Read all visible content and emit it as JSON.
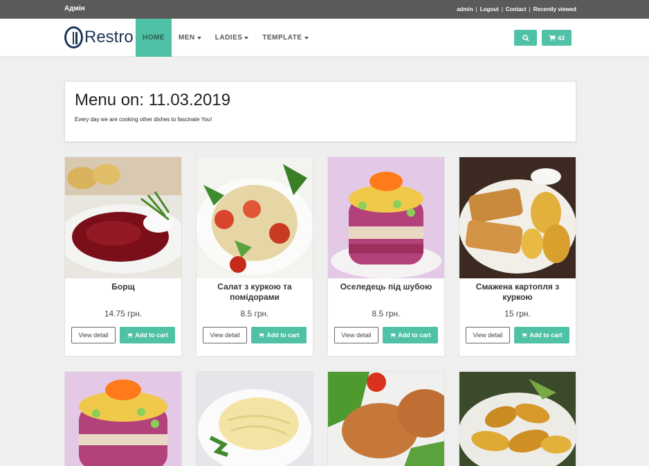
{
  "topbar": {
    "admin_label": "Адмін",
    "links": [
      "admin",
      "Logout",
      "Contact",
      "Recently viewed"
    ]
  },
  "navbar": {
    "logo_text": "Restro",
    "items": [
      {
        "label": "HOME",
        "active": true,
        "dropdown": false
      },
      {
        "label": "MEN",
        "active": false,
        "dropdown": true
      },
      {
        "label": "LADIES",
        "active": false,
        "dropdown": true
      },
      {
        "label": "TEMPLATE",
        "active": false,
        "dropdown": true
      }
    ],
    "search_icon": "search-icon",
    "cart_icon": "cart-icon",
    "cart_count": "43"
  },
  "menu": {
    "title": "Menu on: 11.03.2019",
    "subtitle": "Every day we are cooking other dishes to fascinate You!"
  },
  "products": [
    {
      "name": "Борщ",
      "price": "14.75 грн.",
      "image": "borscht"
    },
    {
      "name": "Салат з куркою та помідорами",
      "price": "8.5 грн.",
      "image": "chicken-salad"
    },
    {
      "name": "Оселедець під шубою",
      "price": "8.5 грн.",
      "image": "herring-salad"
    },
    {
      "name": "Смажена картопля з куркою",
      "price": "15 грн.",
      "image": "fried-potatoes-chicken"
    },
    {
      "name": "",
      "price": "",
      "image": "herring-salad"
    },
    {
      "name": "",
      "price": "",
      "image": "mashed-potatoes"
    },
    {
      "name": "",
      "price": "",
      "image": "cutlets"
    },
    {
      "name": "",
      "price": "",
      "image": "fried-potatoes"
    }
  ],
  "buttons": {
    "view_detail": "View detail",
    "add_to_cart": "Add to cart"
  },
  "colors": {
    "accent": "#4fc1a6",
    "topbar": "#5a5a5a",
    "logo": "#1d3557"
  }
}
